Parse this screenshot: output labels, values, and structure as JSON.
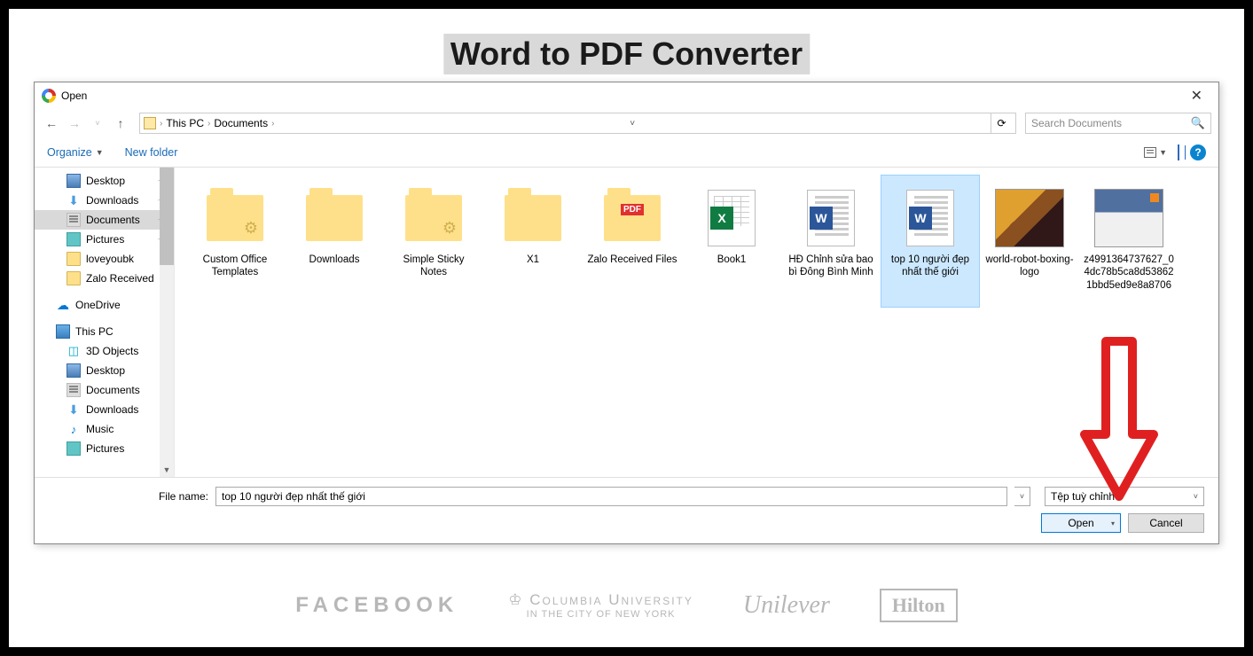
{
  "page": {
    "title": "Word to PDF Converter"
  },
  "dialog": {
    "title": "Open",
    "breadcrumb": {
      "root": "This PC",
      "current": "Documents"
    },
    "search_placeholder": "Search Documents",
    "toolbar": {
      "organize": "Organize",
      "new_folder": "New folder"
    },
    "sidebar": {
      "quick": [
        {
          "label": "Desktop",
          "icon": "desktop",
          "pinned": true
        },
        {
          "label": "Downloads",
          "icon": "down",
          "pinned": true
        },
        {
          "label": "Documents",
          "icon": "doc",
          "pinned": true,
          "selected": true
        },
        {
          "label": "Pictures",
          "icon": "pic",
          "pinned": true
        },
        {
          "label": "loveyoubk",
          "icon": "folder"
        },
        {
          "label": "Zalo Received",
          "icon": "folder"
        }
      ],
      "onedrive": "OneDrive",
      "thispc": {
        "label": "This PC",
        "children": [
          {
            "label": "3D Objects",
            "icon": "3d"
          },
          {
            "label": "Desktop",
            "icon": "desktop"
          },
          {
            "label": "Documents",
            "icon": "doc"
          },
          {
            "label": "Downloads",
            "icon": "down"
          },
          {
            "label": "Music",
            "icon": "music"
          },
          {
            "label": "Pictures",
            "icon": "pic"
          }
        ]
      }
    },
    "files": [
      {
        "label": "Custom Office Templates",
        "thumb": "folder-gear"
      },
      {
        "label": "Downloads",
        "thumb": "folder"
      },
      {
        "label": "Simple Sticky Notes",
        "thumb": "folder-gear"
      },
      {
        "label": "X1",
        "thumb": "folder"
      },
      {
        "label": "Zalo Received Files",
        "thumb": "folder-pdf"
      },
      {
        "label": "Book1",
        "thumb": "excel"
      },
      {
        "label": "HĐ Chỉnh sửa bao bì Đông Bình Minh",
        "thumb": "word"
      },
      {
        "label": "top 10 người đẹp nhất thế giới",
        "thumb": "word",
        "selected": true
      },
      {
        "label": "world-robot-boxing-logo",
        "thumb": "image1"
      },
      {
        "label": "z4991364737627_04dc78b5ca8d538621bbd5ed9e8a8706",
        "thumb": "image2"
      }
    ],
    "footer": {
      "filename_label": "File name:",
      "filename_value": "top 10 người đẹp nhất thế giới",
      "filetype": "Tệp tuỳ chỉnh",
      "open": "Open",
      "cancel": "Cancel"
    }
  },
  "brands": {
    "facebook": "FACEBOOK",
    "columbia_top": "♔ Columbia University",
    "columbia_sub": "IN THE CITY OF NEW YORK",
    "unilever": "Unilever",
    "hilton": "Hilton"
  }
}
